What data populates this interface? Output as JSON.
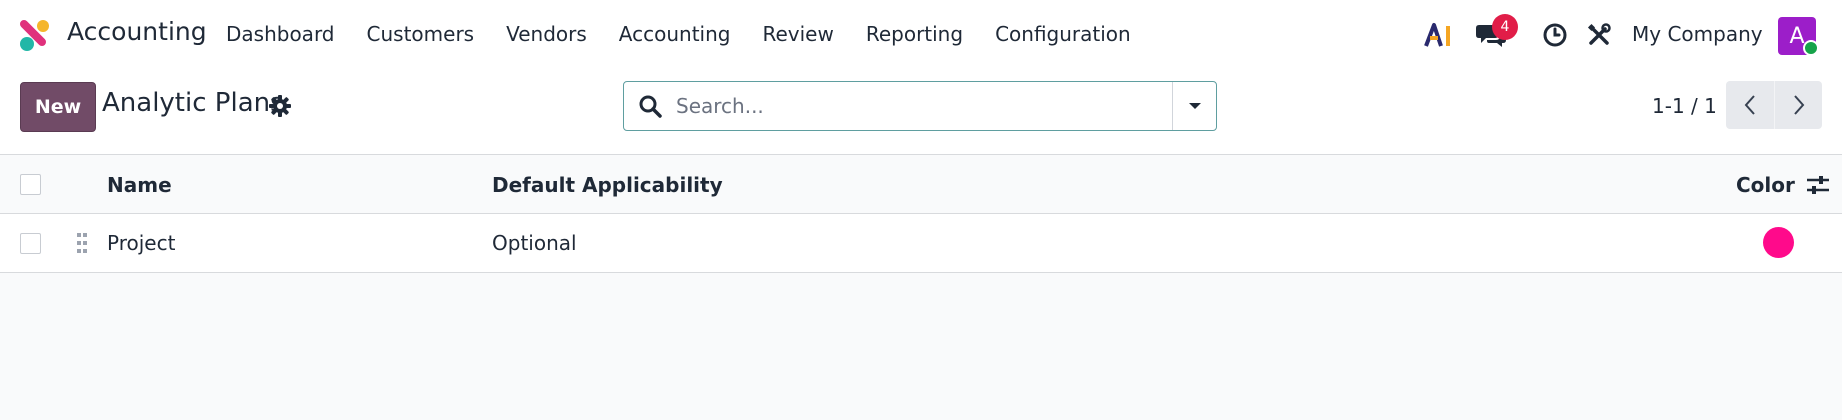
{
  "app": {
    "name": "Accounting",
    "logo_icon": "odoo-accounting-logo-icon",
    "logo_colors": [
      "#e0317c",
      "#f5b62b",
      "#22b7a7"
    ]
  },
  "menu": [
    {
      "label": "Dashboard"
    },
    {
      "label": "Customers"
    },
    {
      "label": "Vendors"
    },
    {
      "label": "Accounting"
    },
    {
      "label": "Review"
    },
    {
      "label": "Reporting"
    },
    {
      "label": "Configuration"
    }
  ],
  "systray": {
    "ai_label": "AI",
    "ai_colors": [
      "#2a2a6e",
      "#f5a623"
    ],
    "messages_badge": "4",
    "activity_icon": "clock-icon",
    "tools_icon": "tools-icon",
    "company": "My Company",
    "avatar_initial": "A",
    "avatar_color": "#9c1ec9",
    "status_color": "#16a34a"
  },
  "control_panel": {
    "new_label": "New",
    "title": "Analytic Plans",
    "search_placeholder": "Search...",
    "search_value": "",
    "pager": "1-1 / 1",
    "accent_color": "#714b67"
  },
  "list": {
    "columns": [
      {
        "label": "Name"
      },
      {
        "label": "Default Applicability"
      },
      {
        "label": "Color"
      }
    ],
    "rows": [
      {
        "name": "Project",
        "default_applicability": "Optional",
        "color": "#ff0a8b"
      }
    ]
  }
}
